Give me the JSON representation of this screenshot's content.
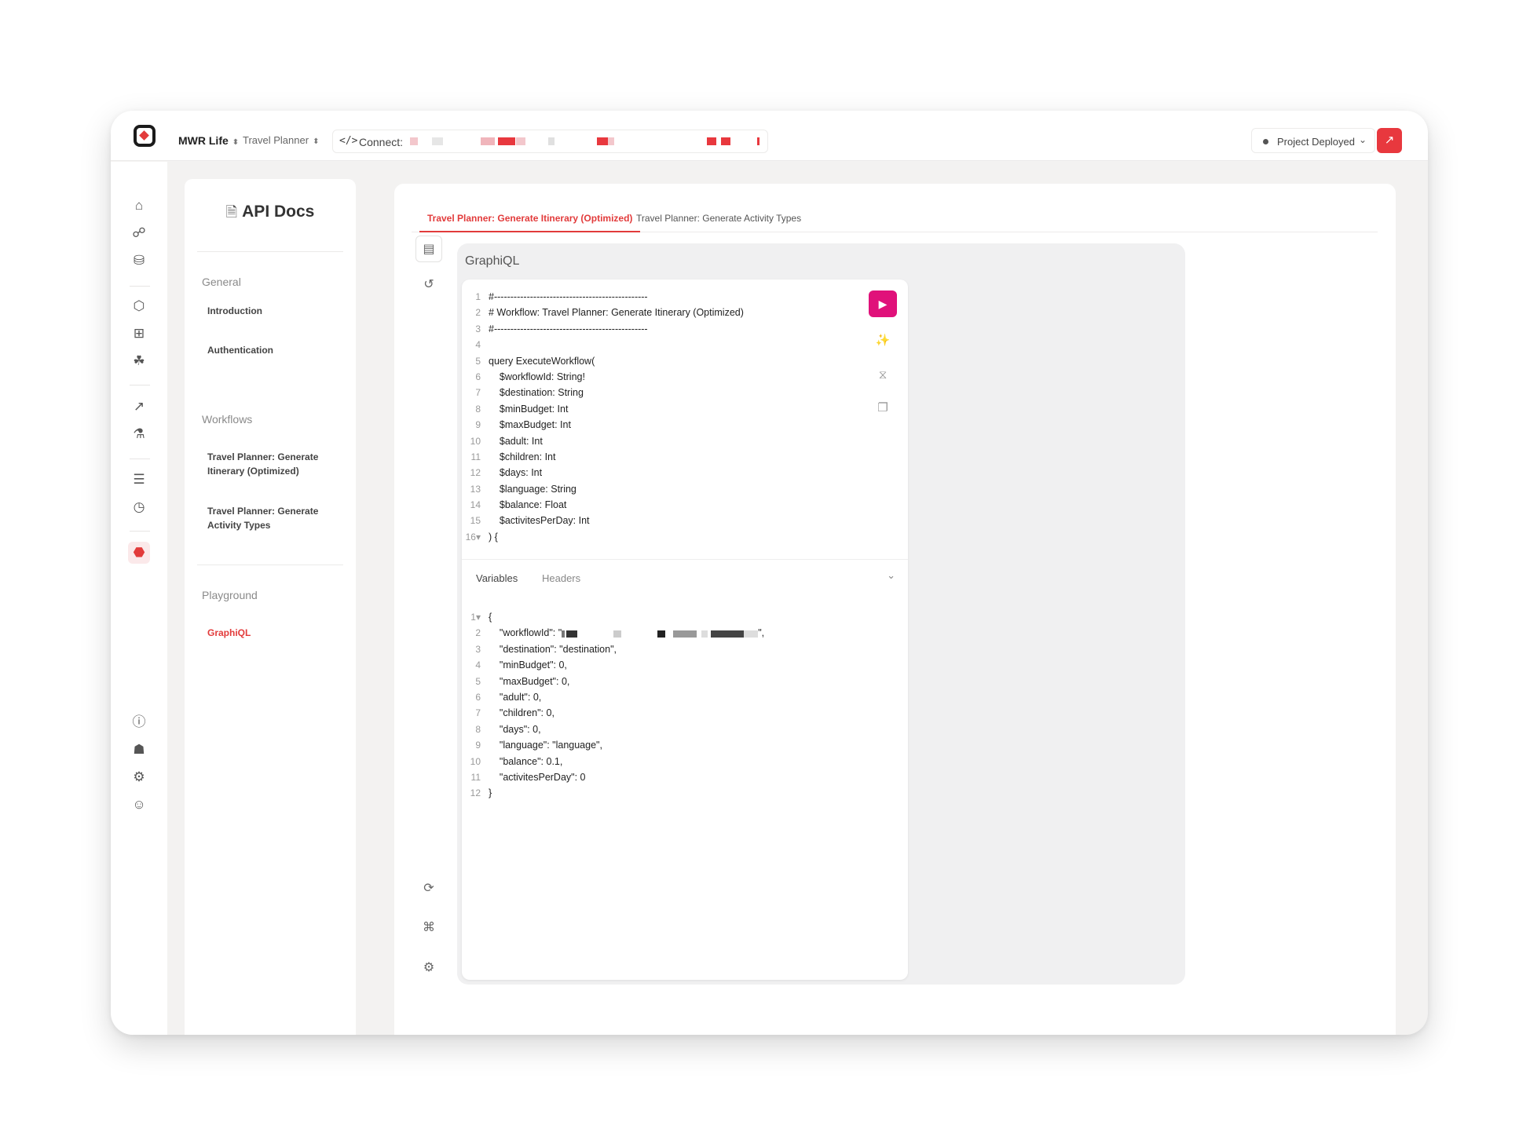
{
  "topbar": {
    "workspace": "MWR Life",
    "project": "Travel Planner",
    "connect_label": "Connect:",
    "status_label": "Project Deployed",
    "colors": {
      "accent": "#e8383e",
      "graphiql_run": "#e0117a"
    }
  },
  "rail": {
    "icons": [
      "home-icon",
      "nodes-icon",
      "database-icon",
      "cube-icon",
      "blocks-icon",
      "cluster-icon",
      "rocket-icon",
      "flask-icon",
      "list-icon",
      "clock-icon",
      "graphql-icon",
      "help-icon",
      "gift-icon",
      "settings-icon",
      "user-icon"
    ]
  },
  "docs": {
    "title": "API Docs",
    "sections": [
      {
        "label": "General",
        "items": [
          "Introduction",
          "Authentication"
        ]
      },
      {
        "label": "Workflows",
        "items": [
          "Travel Planner: Generate Itinerary (Optimized)",
          "Travel Planner: Generate Activity Types"
        ]
      },
      {
        "label": "Playground",
        "items": [
          "GraphiQL"
        ]
      }
    ]
  },
  "main": {
    "tabs": [
      "Travel Planner: Generate Itinerary (Optimized)",
      "Travel Planner: Generate Activity Types"
    ],
    "graphiql_title": "GraphiQL",
    "query_lines": [
      "#-----------------------------------------------",
      "# Workflow: Travel Planner: Generate Itinerary (Optimized)",
      "#-----------------------------------------------",
      "",
      "query ExecuteWorkflow(",
      "    $workflowId: String!",
      "    $destination: String",
      "    $minBudget: Int",
      "    $maxBudget: Int",
      "    $adult: Int",
      "    $children: Int",
      "    $days: Int",
      "    $language: String",
      "    $balance: Float",
      "    $activitesPerDay: Int",
      ") {"
    ],
    "vars_tabs": [
      "Variables",
      "Headers"
    ],
    "variables_lines": [
      "{",
      "    \"workflowId\": \"",
      "    \"destination\": \"destination\",",
      "    \"minBudget\": 0,",
      "    \"maxBudget\": 0,",
      "    \"adult\": 0,",
      "    \"children\": 0,",
      "    \"days\": 0,",
      "    \"language\": \"language\",",
      "    \"balance\": 0.1,",
      "    \"activitesPerDay\": 0",
      "}"
    ],
    "variables_line2_suffix": "\","
  }
}
